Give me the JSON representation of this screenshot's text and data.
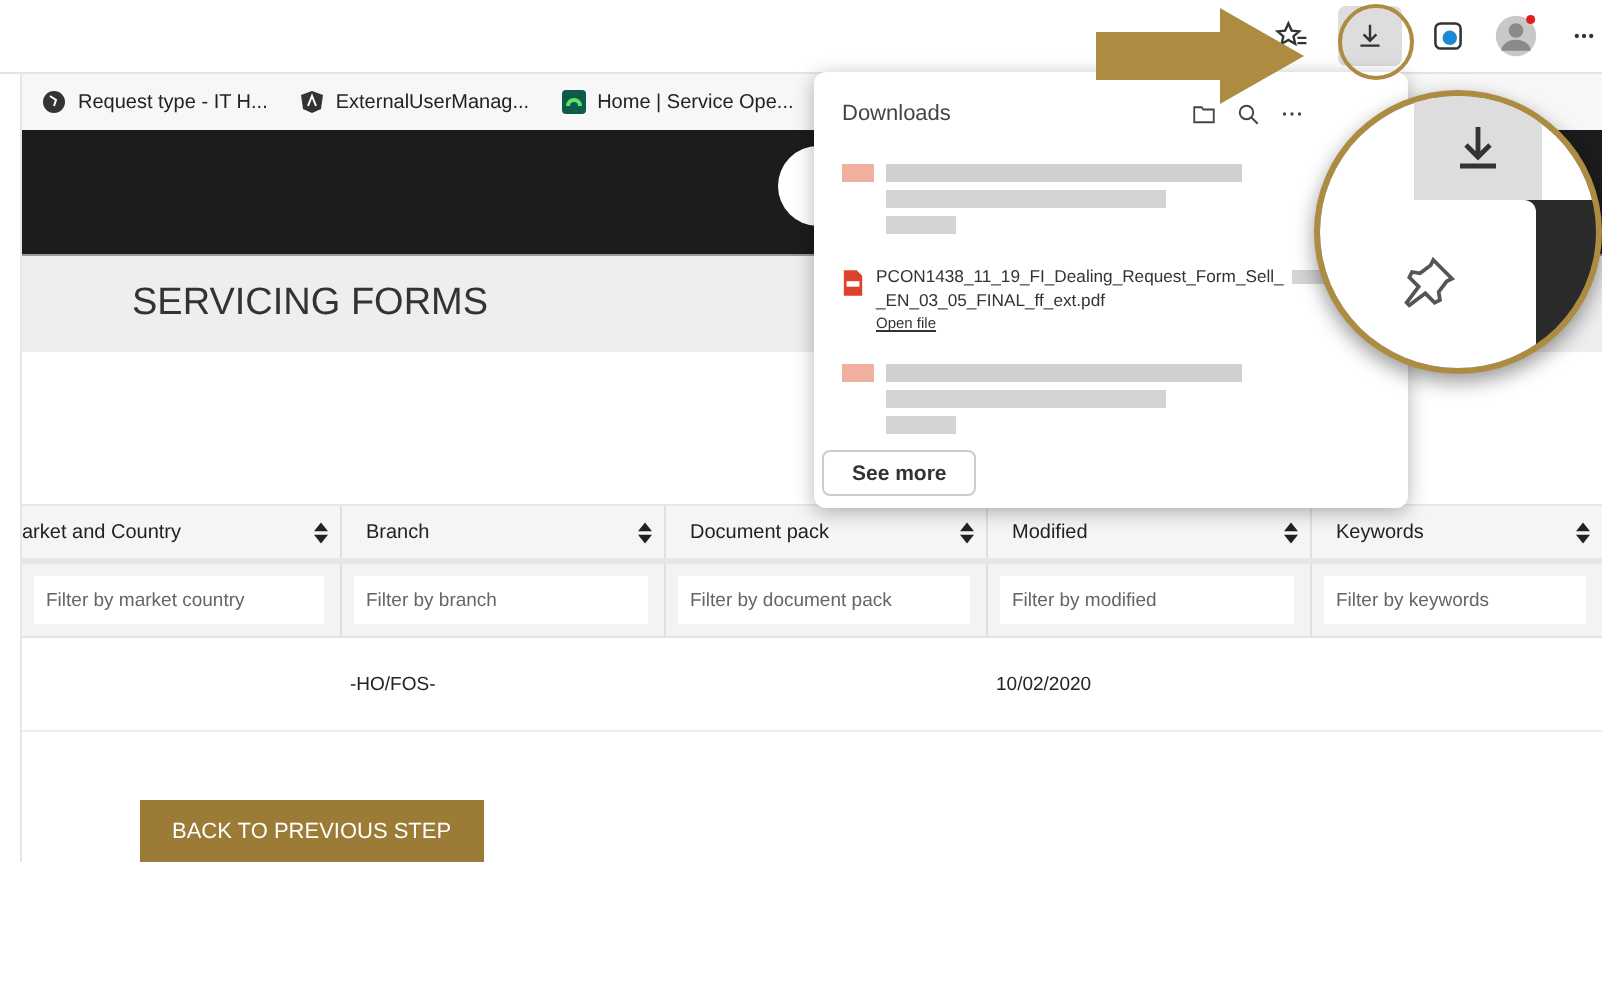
{
  "browser": {
    "bookmarks": [
      {
        "label": "Request type - IT H...",
        "kind": "globe"
      },
      {
        "label": "ExternalUserManag...",
        "kind": "angular"
      },
      {
        "label": "Home | Service Ope...",
        "kind": "service"
      }
    ]
  },
  "page": {
    "title": "SERVICING FORMS",
    "table": {
      "columns": [
        {
          "label": "arket and Country",
          "placeholder": "Filter by market country"
        },
        {
          "label": "Branch",
          "placeholder": "Filter by branch"
        },
        {
          "label": "Document pack",
          "placeholder": "Filter by document pack"
        },
        {
          "label": "Modified",
          "placeholder": "Filter by modified"
        },
        {
          "label": "Keywords",
          "placeholder": "Filter by keywords"
        }
      ],
      "rows": [
        {
          "branch": "-HO/FOS-",
          "modified": "10/02/2020"
        }
      ]
    },
    "back_button": "BACK TO PREVIOUS STEP"
  },
  "downloads_panel": {
    "title": "Downloads",
    "items": [
      {
        "kind": "redacted"
      },
      {
        "kind": "file",
        "name_lines": [
          "PCON1438_11_19_FI_Dealing_Request_Form_Sell_",
          "_EN_03_05_FINAL_ff_ext.pdf"
        ],
        "action": "Open file"
      },
      {
        "kind": "redacted"
      }
    ],
    "see_more": "See more"
  }
}
